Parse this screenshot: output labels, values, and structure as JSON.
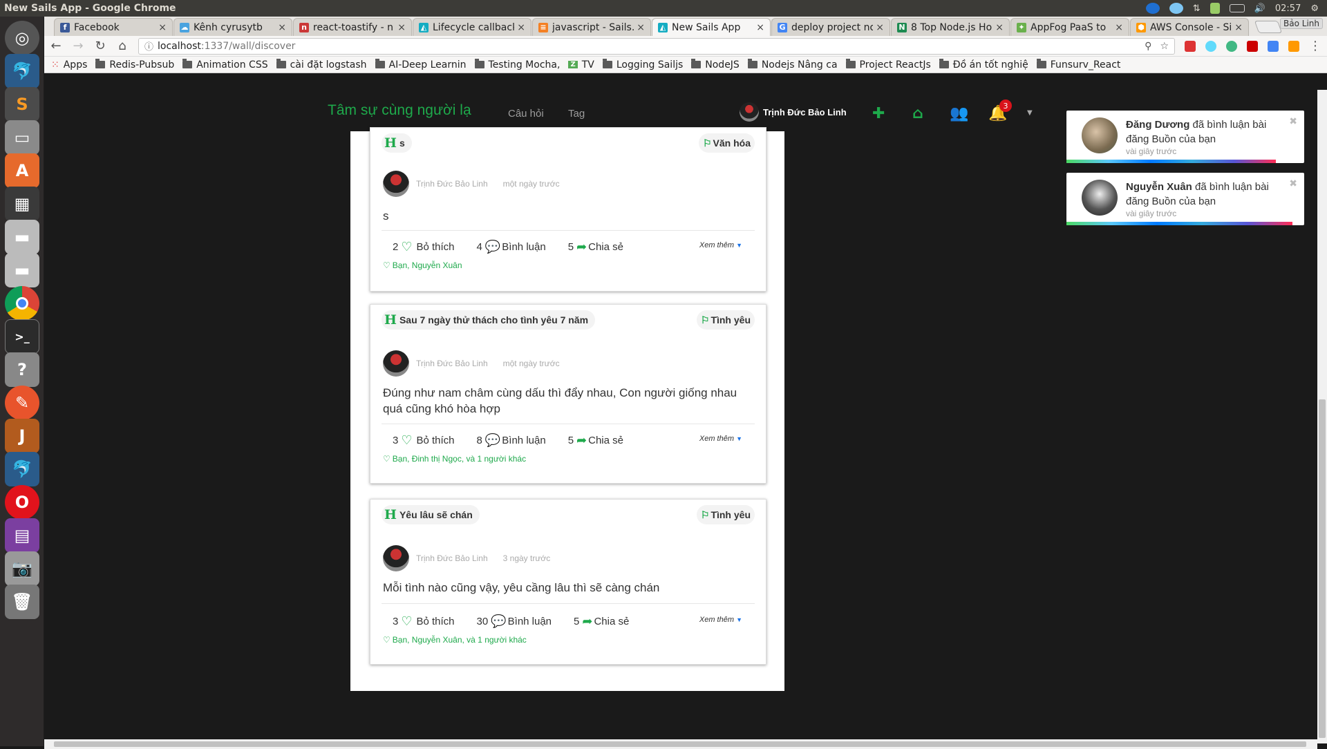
{
  "window": {
    "title": "New Sails App - Google Chrome",
    "clock": "02:57"
  },
  "tabs": [
    {
      "label": "Facebook",
      "color": "#3b5998",
      "glyph": "f"
    },
    {
      "label": "Kênh cyrusytb",
      "color": "#4aa3df",
      "glyph": "☁"
    },
    {
      "label": "react-toastify - n",
      "color": "#cb3837",
      "glyph": "n"
    },
    {
      "label": "Lifecycle callback",
      "color": "#14acc2",
      "glyph": "◭"
    },
    {
      "label": "javascript - Sails.",
      "color": "#f48024",
      "glyph": "≡"
    },
    {
      "label": "New Sails App",
      "color": "#14acc2",
      "glyph": "◭"
    },
    {
      "label": "deploy project no",
      "color": "#4285f4",
      "glyph": "G"
    },
    {
      "label": "8 Top Node.js Ho",
      "color": "#1d8a51",
      "glyph": "N"
    },
    {
      "label": "AppFog PaaS to",
      "color": "#6ab04c",
      "glyph": "✦"
    },
    {
      "label": "AWS Console - Si",
      "color": "#f90",
      "glyph": "⬢"
    }
  ],
  "profile_label": "Bảo Linh",
  "address": {
    "host": "localhost",
    "path": ":1337/wall/discover"
  },
  "bookmarks": [
    "Apps",
    "Redis-Pubsub",
    "Animation CSS",
    "cài đặt logstash",
    "AI-Deep Learnin",
    "Testing Mocha,",
    "TV",
    "Logging Sailjs",
    "NodeJS",
    "Nodejs Nâng ca",
    "Project ReactJs",
    "Đồ án tốt nghiệ",
    "Funsurv_React"
  ],
  "nav": {
    "brand": "Tâm sự cùng người lạ",
    "links": [
      "Câu hỏi",
      "Tag"
    ],
    "user": "Trịnh Đức Bảo Linh",
    "notif_count": "3"
  },
  "posts": [
    {
      "title": "s",
      "tag": "Văn hóa",
      "author": "Trịnh Đức Bảo Linh",
      "time": "một ngày trước",
      "body": "s",
      "likes": "2",
      "like_label": "Bỏ thích",
      "comments": "4",
      "comment_label": "Bình luận",
      "shares": "5",
      "share_label": "Chia sẻ",
      "more": "Xem thêm",
      "liked_by": "Bạn, Nguyễn Xuân"
    },
    {
      "title": "Sau 7 ngày thử thách cho tình yêu 7 năm",
      "tag": "Tình yêu",
      "author": "Trịnh Đức Bảo Linh",
      "time": "một ngày trước",
      "body": "Đúng như nam châm cùng dấu thì đẩy nhau, Con người giống nhau quá cũng khó hòa hợp",
      "likes": "3",
      "like_label": "Bỏ thích",
      "comments": "8",
      "comment_label": "Bình luận",
      "shares": "5",
      "share_label": "Chia sẻ",
      "more": "Xem thêm",
      "liked_by": "Bạn, Đinh thị Ngọc, và 1 người khác"
    },
    {
      "title": "Yêu lâu sẽ chán",
      "tag": "Tình yêu",
      "author": "Trịnh Đức Bảo Linh",
      "time": "3 ngày trước",
      "body": "Mỗi tình nào cũng vậy, yêu cầng lâu thì sẽ càng chán",
      "likes": "3",
      "like_label": "Bỏ thích",
      "comments": "30",
      "comment_label": "Bình luận",
      "shares": "5",
      "share_label": "Chia sẻ",
      "more": "Xem thêm",
      "liked_by": "Bạn, Nguyễn Xuân, và 1 người khác"
    }
  ],
  "toasts": [
    {
      "name": "Đăng Dương",
      "msg": "đã bình luận bài đăng Buồn của bạn",
      "time": "vài giây trước",
      "progress": 0.88
    },
    {
      "name": "Nguyễn Xuân",
      "msg": "đã bình luận bài đăng Buồn của bạn",
      "time": "vài giây trước",
      "progress": 0.95
    }
  ],
  "colors": {
    "brand": "#1ea94b",
    "badge": "#d9131b",
    "navbar": "#1a1a1a"
  }
}
